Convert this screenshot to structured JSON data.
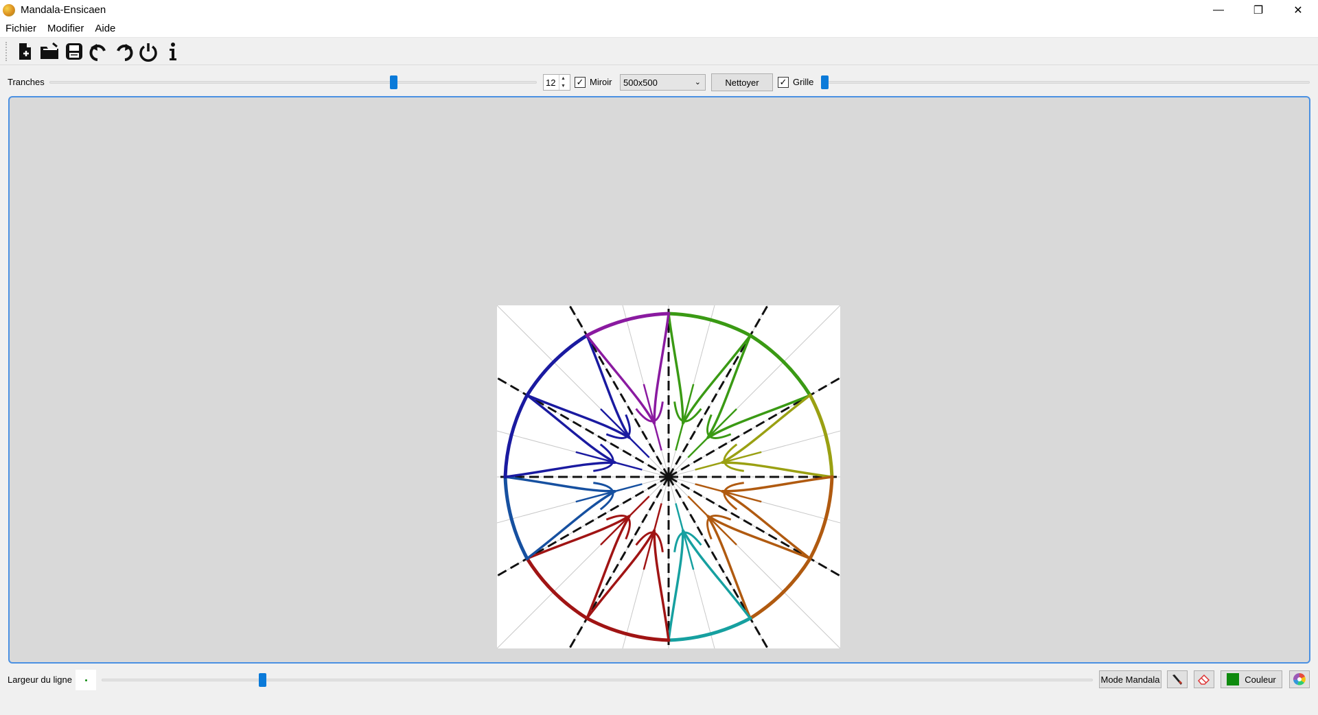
{
  "window": {
    "title": "Mandala-Ensicaen",
    "minimize": "—",
    "maximize": "❐",
    "close": "✕"
  },
  "menu": [
    "Fichier",
    "Modifier",
    "Aide"
  ],
  "toolbar": [
    {
      "icon": "new-file-icon"
    },
    {
      "icon": "open-folder-icon"
    },
    {
      "icon": "save-icon"
    },
    {
      "icon": "undo-icon"
    },
    {
      "icon": "redo-icon"
    },
    {
      "icon": "power-icon"
    },
    {
      "icon": "info-icon"
    }
  ],
  "controls": {
    "slices_label": "Tranches",
    "slices_value": "12",
    "slices_slider_fraction": 0.71,
    "mirror_label": "Miroir",
    "mirror_checked": true,
    "size_selected": "500x500",
    "clear_label": "Nettoyer",
    "grid_label": "Grille",
    "grid_checked": true,
    "grid_slider_fraction": 0.0
  },
  "bottom": {
    "line_width_label": "Largeur du ligne",
    "line_width_fraction": 0.16,
    "mode_label": "Mode Mandala",
    "pen_icon": "pen-icon",
    "eraser_icon": "eraser-icon",
    "color_label": "Couleur",
    "current_color": "#0e8a0e",
    "palette_icon": "color-wheel-icon"
  },
  "canvas": {
    "slices": 12,
    "mirror": true,
    "colors": [
      "#3a9a14",
      "#9aa012",
      "#b05a10",
      "#16a0a0",
      "#a01414",
      "#1650a0",
      "#1a1aa0",
      "#8a1aa0"
    ]
  }
}
